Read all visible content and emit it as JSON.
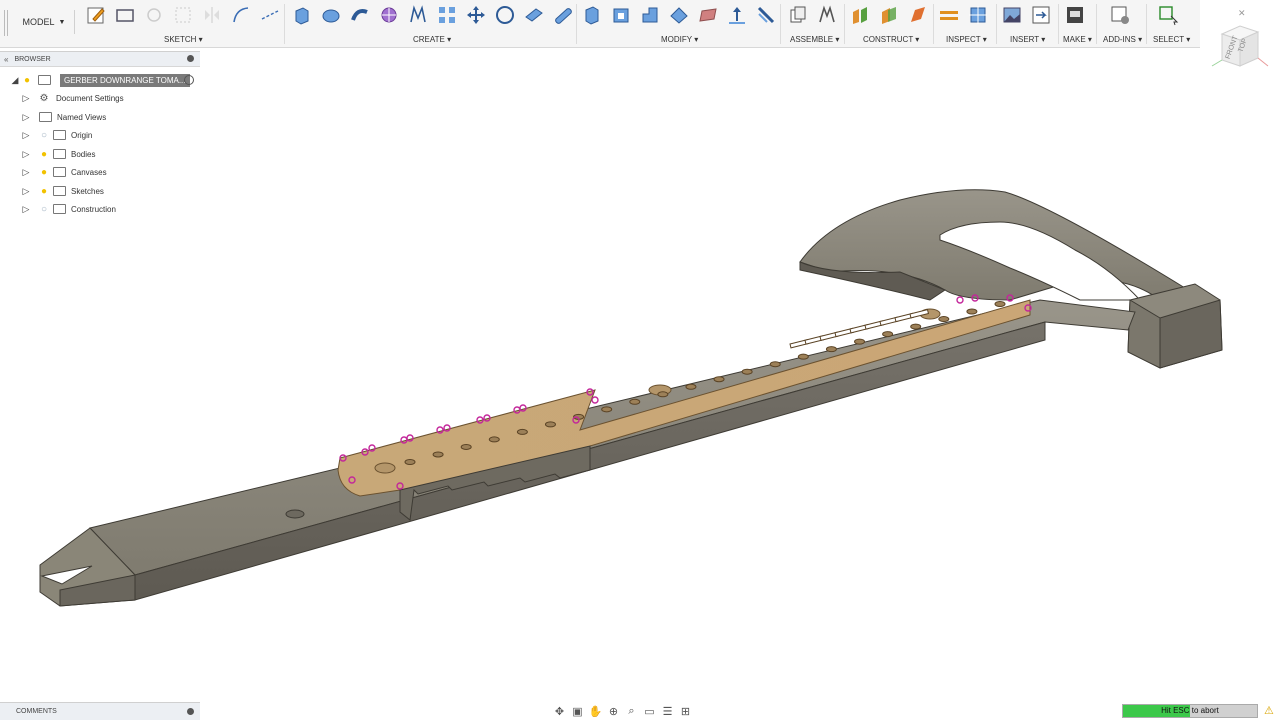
{
  "workspace": {
    "label": "MODEL"
  },
  "toolbar": {
    "groups": [
      {
        "label": "SKETCH ▾"
      },
      {
        "label": "CREATE ▾"
      },
      {
        "label": "MODIFY ▾"
      },
      {
        "label": "ASSEMBLE ▾"
      },
      {
        "label": "CONSTRUCT ▾"
      },
      {
        "label": "INSPECT ▾"
      },
      {
        "label": "INSERT ▾"
      },
      {
        "label": "MAKE ▾"
      },
      {
        "label": "ADD-INS ▾"
      },
      {
        "label": "SELECT ▾"
      }
    ]
  },
  "browser": {
    "title": "BROWSER",
    "root": "GERBER DOWNRANGE TOMA...",
    "items": [
      {
        "label": "Document Settings",
        "icon": "gear-icon"
      },
      {
        "label": "Named Views",
        "icon": "folder-icon"
      },
      {
        "label": "Origin",
        "icon": "folder-icon"
      },
      {
        "label": "Bodies",
        "icon": "folder-icon"
      },
      {
        "label": "Canvases",
        "icon": "folder-icon"
      },
      {
        "label": "Sketches",
        "icon": "folder-icon"
      },
      {
        "label": "Construction",
        "icon": "folder-icon"
      }
    ]
  },
  "comments": {
    "title": "COMMENTS"
  },
  "status": {
    "progress_text": "Hit ESC to abort",
    "progress": 0.5
  },
  "viewcube": {
    "top": "TOP",
    "side": "FRONT"
  },
  "colors": {
    "toolbar_bg": "#f5f5f5",
    "model_gray": "#8a8678",
    "sketch_tan": "#c9ae80",
    "sketch_point": "#c3269a",
    "progress_green": "#3cc84a"
  }
}
